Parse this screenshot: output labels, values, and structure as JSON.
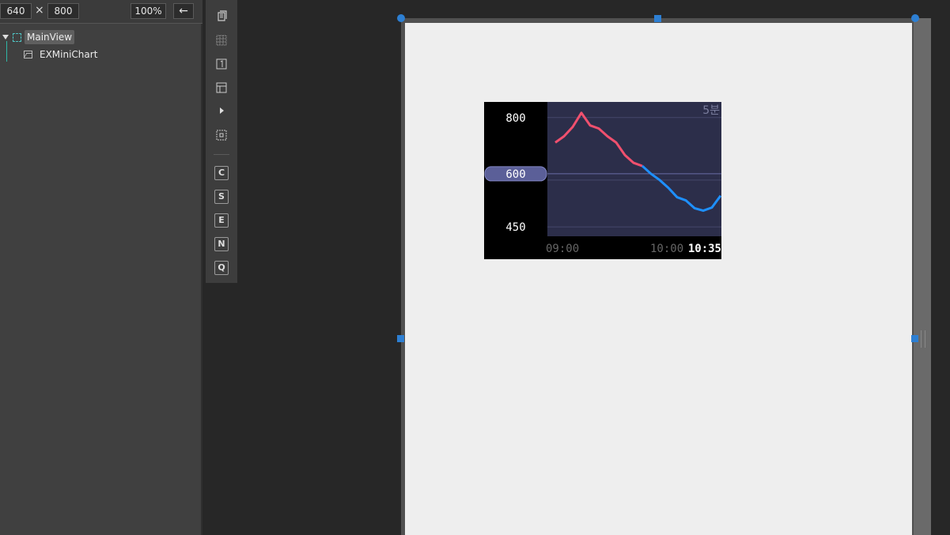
{
  "toolbar_size": {
    "width": "640",
    "height": "800",
    "times": "×",
    "zoom": "100%",
    "back": "←"
  },
  "tree": {
    "root": "MainView",
    "child": "EXMiniChart"
  },
  "tools": {
    "icons": [
      "layers-icon",
      "grid-icon",
      "number-one-icon",
      "layout-icon",
      "play-icon",
      "frame-select-icon"
    ],
    "letters": [
      "C",
      "S",
      "E",
      "N",
      "Q"
    ]
  },
  "colors": {
    "up": "#f0506e",
    "down": "#1e90ff",
    "plot_bg": "#2c2e4a",
    "current_badge": "#5b5f98"
  },
  "chart_data": {
    "type": "line",
    "period_label": "5분",
    "y_ticks": [
      "800",
      "600",
      "450"
    ],
    "current_value_label": "600",
    "x_ticks": [
      "09:00",
      "10:00"
    ],
    "last_time": "10:35",
    "ylim": [
      420,
      850
    ],
    "reference_value": 620,
    "series": [
      {
        "color_key": "up",
        "values": [
          720,
          740,
          770,
          815,
          775,
          765,
          740,
          720,
          680,
          655,
          645
        ]
      },
      {
        "color_key": "down",
        "values": [
          645,
          620,
          600,
          575,
          545,
          535,
          510,
          502,
          512,
          550
        ]
      }
    ]
  }
}
